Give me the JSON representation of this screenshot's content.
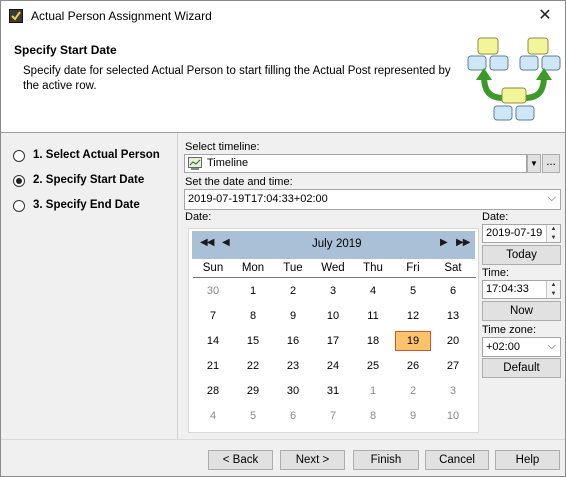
{
  "window": {
    "title": "Actual Person Assignment Wizard"
  },
  "header": {
    "title": "Specify Start Date",
    "description": "Specify date for selected Actual Person to start filling the Actual Post represented by the active row."
  },
  "steps": [
    {
      "label": "1. Select Actual Person",
      "checked": false
    },
    {
      "label": "2. Specify Start Date",
      "checked": true
    },
    {
      "label": "3. Specify End Date",
      "checked": false
    }
  ],
  "form": {
    "timeline_label": "Select timeline:",
    "timeline_value": "Timeline",
    "browse_label": "...",
    "datetime_label": "Set the date and time:",
    "datetime_value": "2019-07-19T17:04:33+02:00",
    "date_label": "Date:"
  },
  "calendar": {
    "month": "July",
    "year": "2019",
    "weekdays": [
      "Sun",
      "Mon",
      "Tue",
      "Wed",
      "Thu",
      "Fri",
      "Sat"
    ],
    "selected_day": "19",
    "weeks": [
      [
        "30",
        "1",
        "2",
        "3",
        "4",
        "5",
        "6"
      ],
      [
        "7",
        "8",
        "9",
        "10",
        "11",
        "12",
        "13"
      ],
      [
        "14",
        "15",
        "16",
        "17",
        "18",
        "19",
        "20"
      ],
      [
        "21",
        "22",
        "23",
        "24",
        "25",
        "26",
        "27"
      ],
      [
        "28",
        "29",
        "30",
        "31",
        "1",
        "2",
        "3"
      ],
      [
        "4",
        "5",
        "6",
        "7",
        "8",
        "9",
        "10"
      ]
    ]
  },
  "right_panel": {
    "date_label": "Date:",
    "date_value": "2019-07-19",
    "today_button": "Today",
    "time_label": "Time:",
    "time_value": "17:04:33",
    "now_button": "Now",
    "timezone_label": "Time zone:",
    "timezone_value": "+02:00",
    "default_button": "Default"
  },
  "footer": {
    "back": "< Back",
    "next": "Next >",
    "finish": "Finish",
    "cancel": "Cancel",
    "help": "Help"
  }
}
